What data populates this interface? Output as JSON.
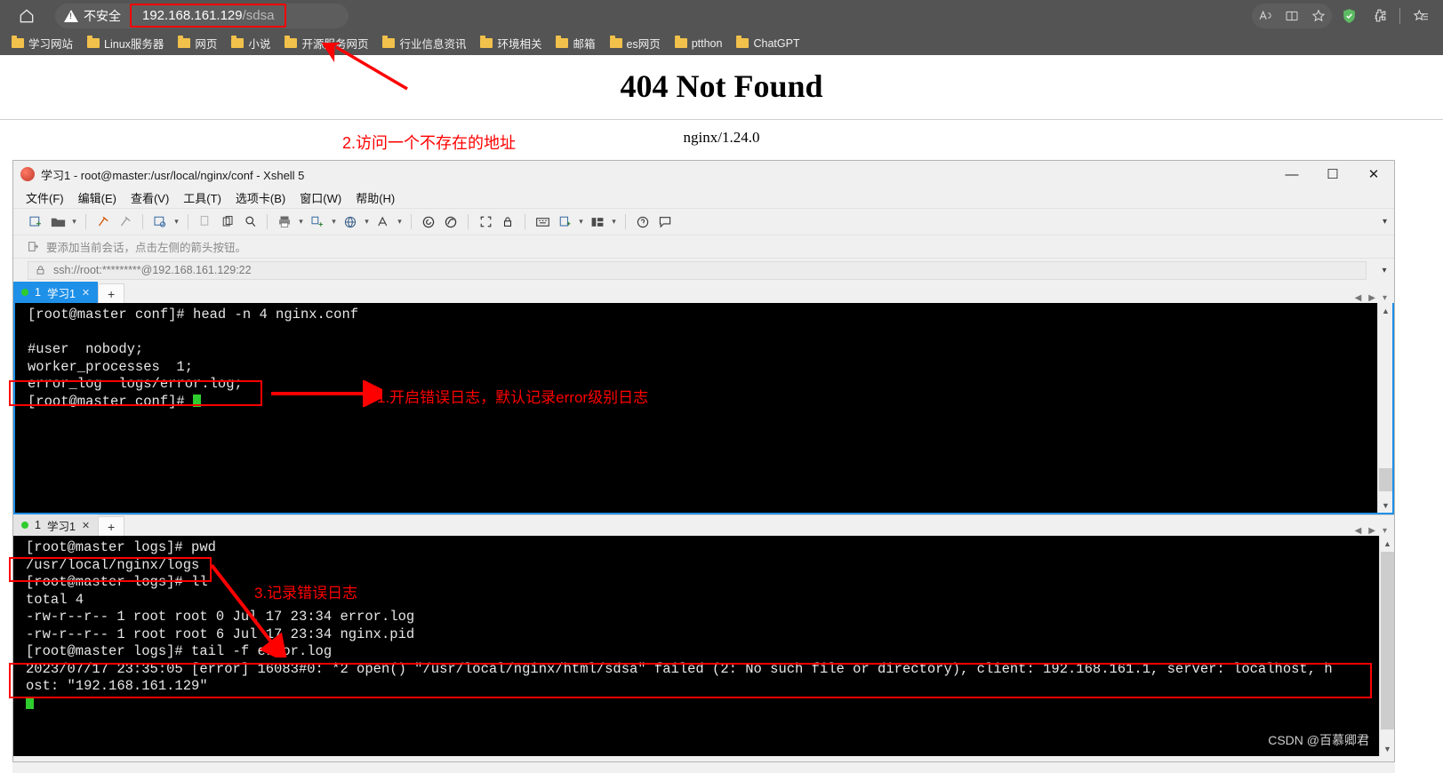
{
  "browser": {
    "home_icon": "home-icon",
    "security_label": "不安全",
    "url_host": "192.168.161.129",
    "url_path": "/sdsa",
    "toolbar_icons": [
      {
        "name": "read-aloud-icon",
        "glyph": "A⁾"
      },
      {
        "name": "split-screen-icon",
        "glyph": "◫"
      },
      {
        "name": "favorite-star-icon",
        "glyph": "☆"
      },
      {
        "name": "adguard-shield-icon",
        "glyph": "✓"
      },
      {
        "name": "extensions-puzzle-icon",
        "glyph": "✦"
      },
      {
        "name": "collections-icon",
        "glyph": "☆"
      }
    ],
    "bookmarks": [
      "学习网站",
      "Linux服务器",
      "网页",
      "小说",
      "开源服务网页",
      "行业信息资讯",
      "环境相关",
      "邮箱",
      "es网页",
      "ptthon",
      "ChatGPT"
    ]
  },
  "page": {
    "title": "404 Not Found",
    "server": "nginx/1.24.0",
    "annotation_2": "2.访问一个不存在的地址"
  },
  "xshell": {
    "window_title": "学习1 - root@master:/usr/local/nginx/conf - Xshell 5",
    "window_controls": {
      "minimize": "—",
      "maximize": "☐",
      "close": "✕"
    },
    "menus": [
      "文件(F)",
      "编辑(E)",
      "查看(V)",
      "工具(T)",
      "选项卡(B)",
      "窗口(W)",
      "帮助(H)"
    ],
    "toolbar_icons": [
      "new-session-icon",
      "open-folder-icon",
      "folder-caret-icon",
      "connect-icon",
      "disconnect-icon",
      "session-properties-icon",
      "properties-caret-icon",
      "copy-icon",
      "paste-icon",
      "find-icon",
      "print-icon",
      "print-caret-icon",
      "transfer-icon",
      "transfer-caret-icon",
      "globe-icon",
      "globe-caret-icon",
      "font-icon",
      "font-caret-icon",
      "log-icon",
      "record-icon",
      "fullscreen-icon",
      "lock-icon",
      "keyboard-icon",
      "compose-icon",
      "compose-caret-icon",
      "layout-icon",
      "layout-caret-icon",
      "help-icon",
      "chat-icon"
    ],
    "hint": "要添加当前会话，点击左侧的箭头按钮。",
    "address": "ssh://root:*********@192.168.161.129:22",
    "tab_top": {
      "index": "1",
      "label": "学习1",
      "close": "✕",
      "add": "+"
    },
    "tab_bottom": {
      "index": "1",
      "label": "学习1",
      "close": "✕",
      "add": "+"
    }
  },
  "terminal_top": {
    "lines": [
      "[root@master conf]# head -n 4 nginx.conf",
      "",
      "#user  nobody;",
      "worker_processes  1;",
      "error_log  logs/error.log;",
      "[root@master conf]# "
    ],
    "annotation_1": "1.开启错误日志，默认记录error级别日志",
    "highlight_line": "error_log  logs/error.log;"
  },
  "terminal_bottom": {
    "lines": [
      "[root@master logs]# pwd",
      "/usr/local/nginx/logs",
      "[root@master logs]# ll",
      "total 4",
      "-rw-r--r-- 1 root root 0 Jul 17 23:34 error.log",
      "-rw-r--r-- 1 root root 6 Jul 17 23:34 nginx.pid",
      "[root@master logs]# tail -f error.log",
      "2023/07/17 23:35:05 [error] 16083#0: *2 open() \"/usr/local/nginx/html/sdsa\" failed (2: No such file or directory), client: 192.168.161.1, server: localhost, h",
      "ost: \"192.168.161.129\""
    ],
    "annotation_3": "3.记录错误日志",
    "highlight_line": "/usr/local/nginx/logs"
  },
  "watermark": "CSDN @百慕卿君",
  "colors": {
    "chrome_bg": "#545454",
    "accent_blue": "#1e90e8",
    "annotation_red": "#ff0000",
    "terminal_bg": "#000000",
    "terminal_fg": "#e6e6e6",
    "cursor_green": "#2ecc2e"
  }
}
